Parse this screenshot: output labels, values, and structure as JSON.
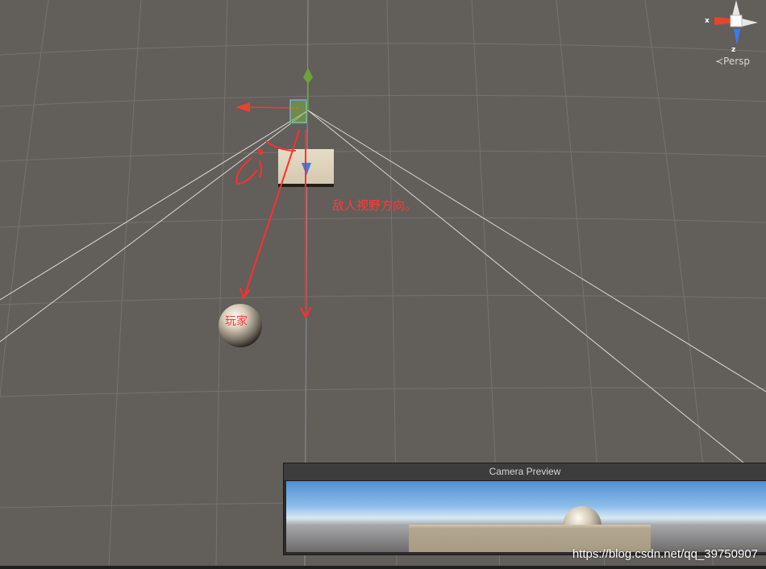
{
  "scene": {
    "enemy_view_label": "敌人视野方向。",
    "player_label": "玩家"
  },
  "gizmo": {
    "x_axis_label": "x",
    "z_axis_label": "z",
    "projection_label": "≺Persp"
  },
  "camera_preview": {
    "title": "Camera Preview"
  },
  "watermark": "https://blog.csdn.net/qq_39750907",
  "colors": {
    "background": "#625e5a",
    "annotation_red": "#ff3b3b",
    "axis_x_red": "#e8432c",
    "axis_y_green": "#6ca23c",
    "axis_z_blue": "#3a7bf0"
  }
}
